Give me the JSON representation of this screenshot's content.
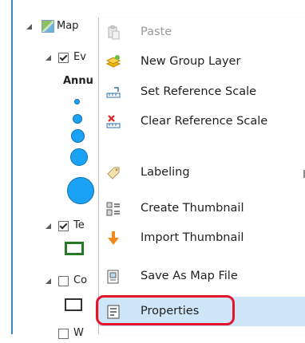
{
  "tree": {
    "items": [
      {
        "label": "Map",
        "checked": false
      },
      {
        "label": "Ev",
        "checked": true
      },
      {
        "label": "Annu"
      },
      {
        "label": "Te",
        "checked": true
      },
      {
        "label": "Co",
        "checked": false
      },
      {
        "label": "W",
        "checked": false
      }
    ]
  },
  "context_menu": {
    "items": [
      {
        "label": "Paste",
        "icon": "paste-icon",
        "enabled": false
      },
      {
        "label": "New Group Layer",
        "icon": "new-group-layer-icon",
        "enabled": true
      },
      {
        "label": "Set Reference Scale",
        "icon": "set-reference-scale-icon",
        "enabled": true
      },
      {
        "label": "Clear Reference Scale",
        "icon": "clear-reference-scale-icon",
        "enabled": true
      },
      {
        "label": "Labeling",
        "icon": "labeling-icon",
        "enabled": true,
        "has_submenu": true
      },
      {
        "label": "Create Thumbnail",
        "icon": "create-thumbnail-icon",
        "enabled": true
      },
      {
        "label": "Import Thumbnail",
        "icon": "import-thumbnail-icon",
        "enabled": true
      },
      {
        "label": "Save As Map File",
        "icon": "save-as-map-file-icon",
        "enabled": true
      },
      {
        "label": "Properties",
        "icon": "properties-icon",
        "enabled": true,
        "selected": true
      }
    ]
  },
  "colors": {
    "selection_bg": "#cfe6f8",
    "highlight_border": "#e4142c",
    "symbol_fill": "#1aa3f5",
    "tree_accent": "#3d86c6"
  }
}
